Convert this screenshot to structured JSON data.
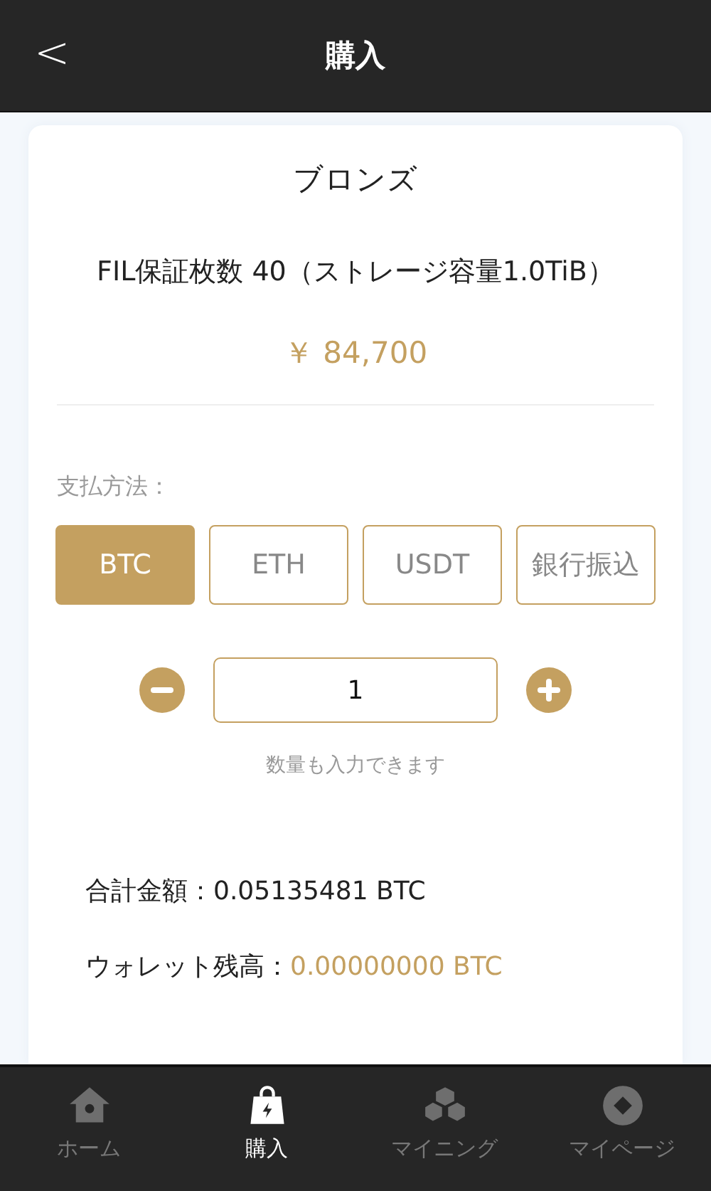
{
  "header": {
    "back": "<",
    "title": "購入"
  },
  "product": {
    "tier": "ブロンズ",
    "name": "FIL保証枚数 40（ストレージ容量1.0TiB）",
    "price": "￥ 84,700"
  },
  "payment": {
    "label": "支払方法：",
    "methods": [
      {
        "label": "BTC",
        "selected": true
      },
      {
        "label": "ETH",
        "selected": false
      },
      {
        "label": "USDT",
        "selected": false
      },
      {
        "label": "銀行振込",
        "selected": false
      }
    ]
  },
  "quantity": {
    "value": "1",
    "hint": "数量も入力できます"
  },
  "summary": [
    {
      "label": "合計金額：",
      "value": "0.05135481 BTC",
      "highlight": false
    },
    {
      "label": "ウォレット残高：",
      "value": "0.00000000 BTC",
      "highlight": true
    }
  ],
  "nav": [
    {
      "kind": "home",
      "label": "ホーム",
      "selected": false
    },
    {
      "kind": "buy",
      "label": "購入",
      "selected": true
    },
    {
      "kind": "mining",
      "label": "マイニング",
      "selected": false
    },
    {
      "kind": "mypage",
      "label": "マイページ",
      "selected": false
    }
  ]
}
